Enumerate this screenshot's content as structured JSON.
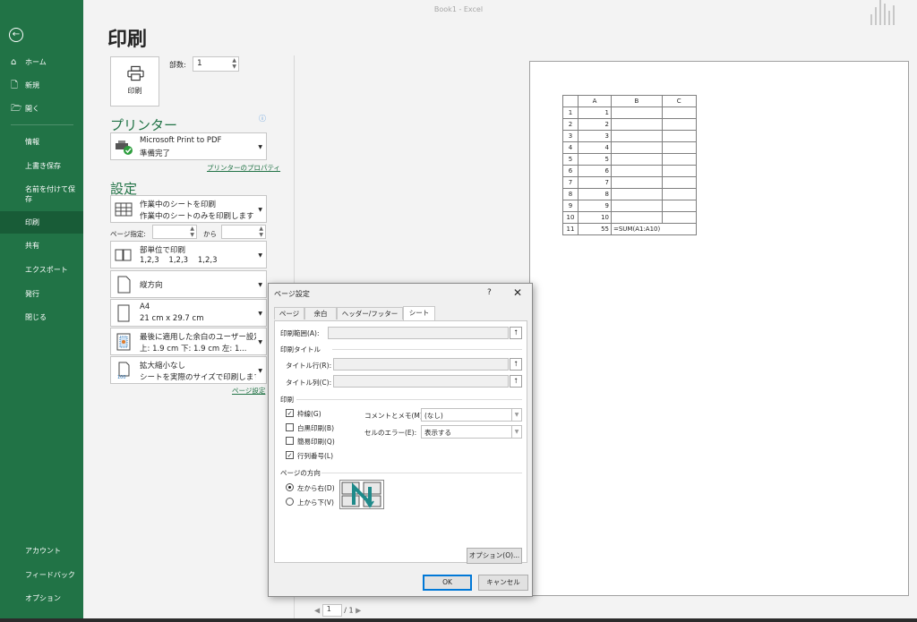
{
  "window": {
    "title": "Book1  -  Excel"
  },
  "sidebar": {
    "back_icon": "back-arrow-icon",
    "items": [
      {
        "label": "ホーム",
        "icon": "home-icon"
      },
      {
        "label": "新規",
        "icon": "new-document-icon"
      },
      {
        "label": "開く",
        "icon": "folder-open-icon"
      },
      {
        "label": "情報"
      },
      {
        "label": "上書き保存"
      },
      {
        "label": "名前を付けて保存"
      },
      {
        "label": "印刷",
        "active": true
      },
      {
        "label": "共有"
      },
      {
        "label": "エクスポート"
      },
      {
        "label": "発行"
      },
      {
        "label": "閉じる"
      }
    ],
    "bottom_items": [
      {
        "label": "アカウント"
      },
      {
        "label": "フィードバック"
      },
      {
        "label": "オプション"
      }
    ]
  },
  "page": {
    "title": "印刷"
  },
  "print": {
    "button_label": "印刷",
    "copies_label": "部数:",
    "copies_value": "1"
  },
  "printer": {
    "section_title": "プリンター",
    "name": "Microsoft Print to PDF",
    "status": "準備完了",
    "properties_link": "プリンターのプロパティ"
  },
  "settings": {
    "section_title": "設定",
    "scope": {
      "line1": "作業中のシートを印刷",
      "line2": "作業中のシートのみを印刷します"
    },
    "pages_label": "ページ指定:",
    "pages_to": "から",
    "collate": {
      "line1": "部単位で印刷",
      "line2": "1,2,3    1,2,3    1,2,3"
    },
    "orientation": {
      "line1": "縦方向"
    },
    "paper": {
      "line1": "A4",
      "line2": "21 cm x 29.7 cm"
    },
    "margins": {
      "line1": "最後に適用した余白のユーザー設定",
      "line2": "上: 1.9 cm 下: 1.9 cm 左: 1..."
    },
    "scaling": {
      "line1": "拡大縮小なし",
      "line2": "シートを実際のサイズで印刷します"
    },
    "page_setup_link": "ページ設定"
  },
  "preview": {
    "headers": [
      "",
      "A",
      "B",
      "C"
    ],
    "rows": [
      [
        "1",
        "1",
        "",
        ""
      ],
      [
        "2",
        "2",
        "",
        ""
      ],
      [
        "3",
        "3",
        "",
        ""
      ],
      [
        "4",
        "4",
        "",
        ""
      ],
      [
        "5",
        "5",
        "",
        ""
      ],
      [
        "6",
        "6",
        "",
        ""
      ],
      [
        "7",
        "7",
        "",
        ""
      ],
      [
        "8",
        "8",
        "",
        ""
      ],
      [
        "9",
        "9",
        "",
        ""
      ],
      [
        "10",
        "10",
        "",
        ""
      ],
      [
        "11",
        "55",
        "=SUM(A1:A10)",
        ""
      ]
    ],
    "page_current": "1",
    "page_total": "/ 1"
  },
  "dialog": {
    "title": "ページ設定",
    "help": "?",
    "close": "✕",
    "tabs": [
      "ページ",
      "余白",
      "ヘッダー/フッター",
      "シート"
    ],
    "print_area_label": "印刷範囲(A):",
    "print_titles_label": "印刷タイトル",
    "title_rows_label": "タイトル行(R):",
    "title_cols_label": "タイトル列(C):",
    "print_section_label": "印刷",
    "checkboxes": [
      {
        "label": "枠線(G)",
        "checked": true
      },
      {
        "label": "白黒印刷(B)",
        "checked": false
      },
      {
        "label": "簡易印刷(Q)",
        "checked": false
      },
      {
        "label": "行列番号(L)",
        "checked": true
      }
    ],
    "comments_label": "コメントとメモ(M):",
    "comments_value": "(なし)",
    "errors_label": "セルのエラー(E):",
    "errors_value": "表示する",
    "order_section_label": "ページの方向",
    "radios": [
      {
        "label": "左から右(D)",
        "checked": true
      },
      {
        "label": "上から下(V)",
        "checked": false
      }
    ],
    "options_button": "オプション(O)...",
    "ok_button": "OK",
    "cancel_button": "キャンセル"
  }
}
